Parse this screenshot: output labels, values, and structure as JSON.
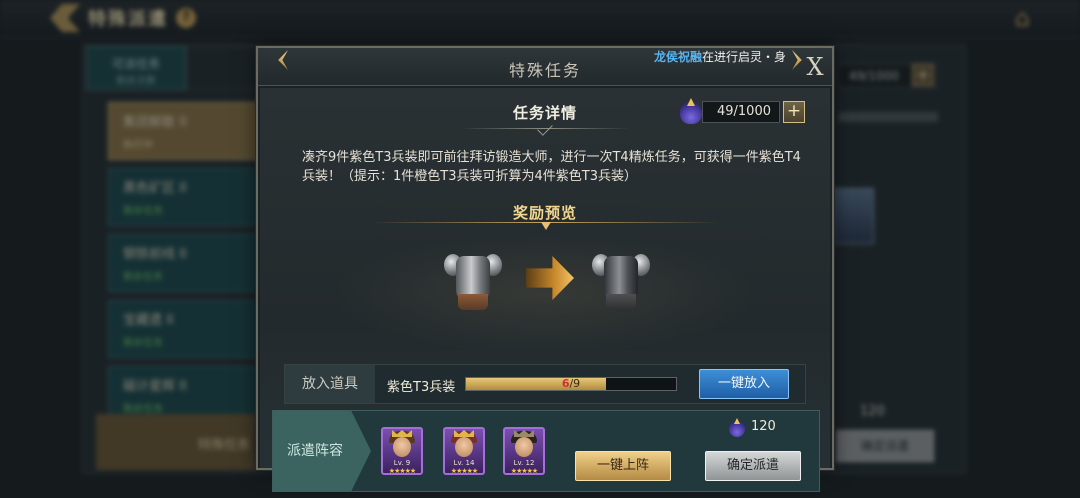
{
  "background": {
    "title": "特殊派遣",
    "help_icon": "?",
    "home_icon": "home-icon",
    "tabs": [
      {
        "label": "可派任务",
        "sub": "剩余次数"
      },
      {
        "label": "",
        "sub": ""
      }
    ],
    "list_items": [
      {
        "name": "集团解散 II",
        "status": "执行中"
      },
      {
        "name": "黑色矿区 II",
        "status": "剩余任务"
      },
      {
        "name": "钢铁前线 II",
        "status": "剩余任务"
      },
      {
        "name": "宝藏遗 II",
        "status": "剩余任务"
      },
      {
        "name": "磁计星辉 II",
        "status": "剩余任务"
      }
    ],
    "bottom_tab": "特殊任务",
    "right_counter": "49/1000",
    "right_cost": "120",
    "right_button": "确定派遣"
  },
  "modal": {
    "title": "特殊任务",
    "ticker": {
      "name": "龙侯祝融",
      "message": "在进行启灵・身"
    },
    "close_label": "X",
    "detail_title": "任务详情",
    "stamina": {
      "icon": "potion-icon",
      "value": "49/1000",
      "plus_label": "+"
    },
    "description": "凑齐9件紫色T3兵装即可前往拜访锻造大师，进行一次T4精炼任务，可获得一件紫色T4兵装！（提示：1件橙色T3兵装可折算为4件紫色T3兵装）",
    "reward_title": "奖励预览",
    "reward": {
      "from_icon": "armor-t3-icon",
      "to_icon": "armor-t4-icon",
      "arrow_icon": "arrow-right-icon"
    },
    "item_row": {
      "label": "放入道具",
      "item_name": "紫色T3兵装",
      "progress_current": "6",
      "progress_total": "/9",
      "progress_fraction": 0.6667,
      "button": "一键放入"
    },
    "dispatch": {
      "label": "派遣阵容",
      "heroes": [
        {
          "level": "Lv. 9",
          "stars": "★★★★★"
        },
        {
          "level": "Lv. 14",
          "stars": "★★★★★"
        },
        {
          "level": "Lv. 12",
          "stars": "★★★★★"
        }
      ],
      "cost_icon": "potion-icon",
      "cost_value": "120",
      "auto_button": "一键上阵",
      "confirm_button": "确定派遣"
    }
  },
  "colors": {
    "gold_accent": "#f3d78d",
    "ticker_name": "#56b4f0",
    "blue_button": "#2f78c4",
    "progress_current": "#d0312d"
  }
}
